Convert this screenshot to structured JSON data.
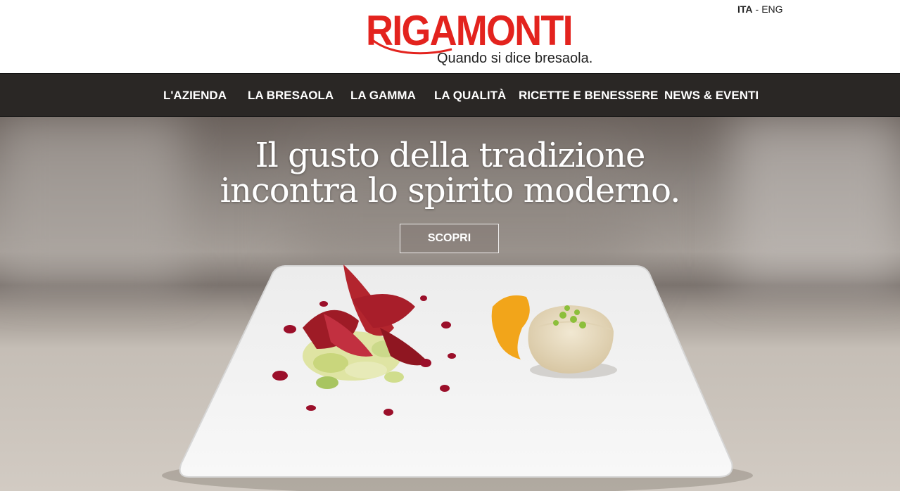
{
  "header": {
    "logo_text": "RIGAMONTI",
    "tagline": "Quando si dice bresaola.",
    "lang": {
      "ita": "ITA",
      "sep": "-",
      "eng": "ENG"
    }
  },
  "nav": {
    "items": [
      {
        "label": "L'AZIENDA"
      },
      {
        "label": "LA BRESAOLA"
      },
      {
        "label": "LA GAMMA"
      },
      {
        "label": "LA QUALITÀ"
      },
      {
        "label": "RICETTE E BENESSERE"
      },
      {
        "label": "NEWS & EVENTI"
      }
    ]
  },
  "hero": {
    "title_line1": "Il gusto della tradizione",
    "title_line2": "incontra lo spirito moderno.",
    "cta_label": "SCOPRI"
  },
  "colors": {
    "brand_red": "#e3231e",
    "nav_bg": "#2a2725",
    "sauce": "#9b0f2a",
    "yolk": "#f2a51a"
  }
}
